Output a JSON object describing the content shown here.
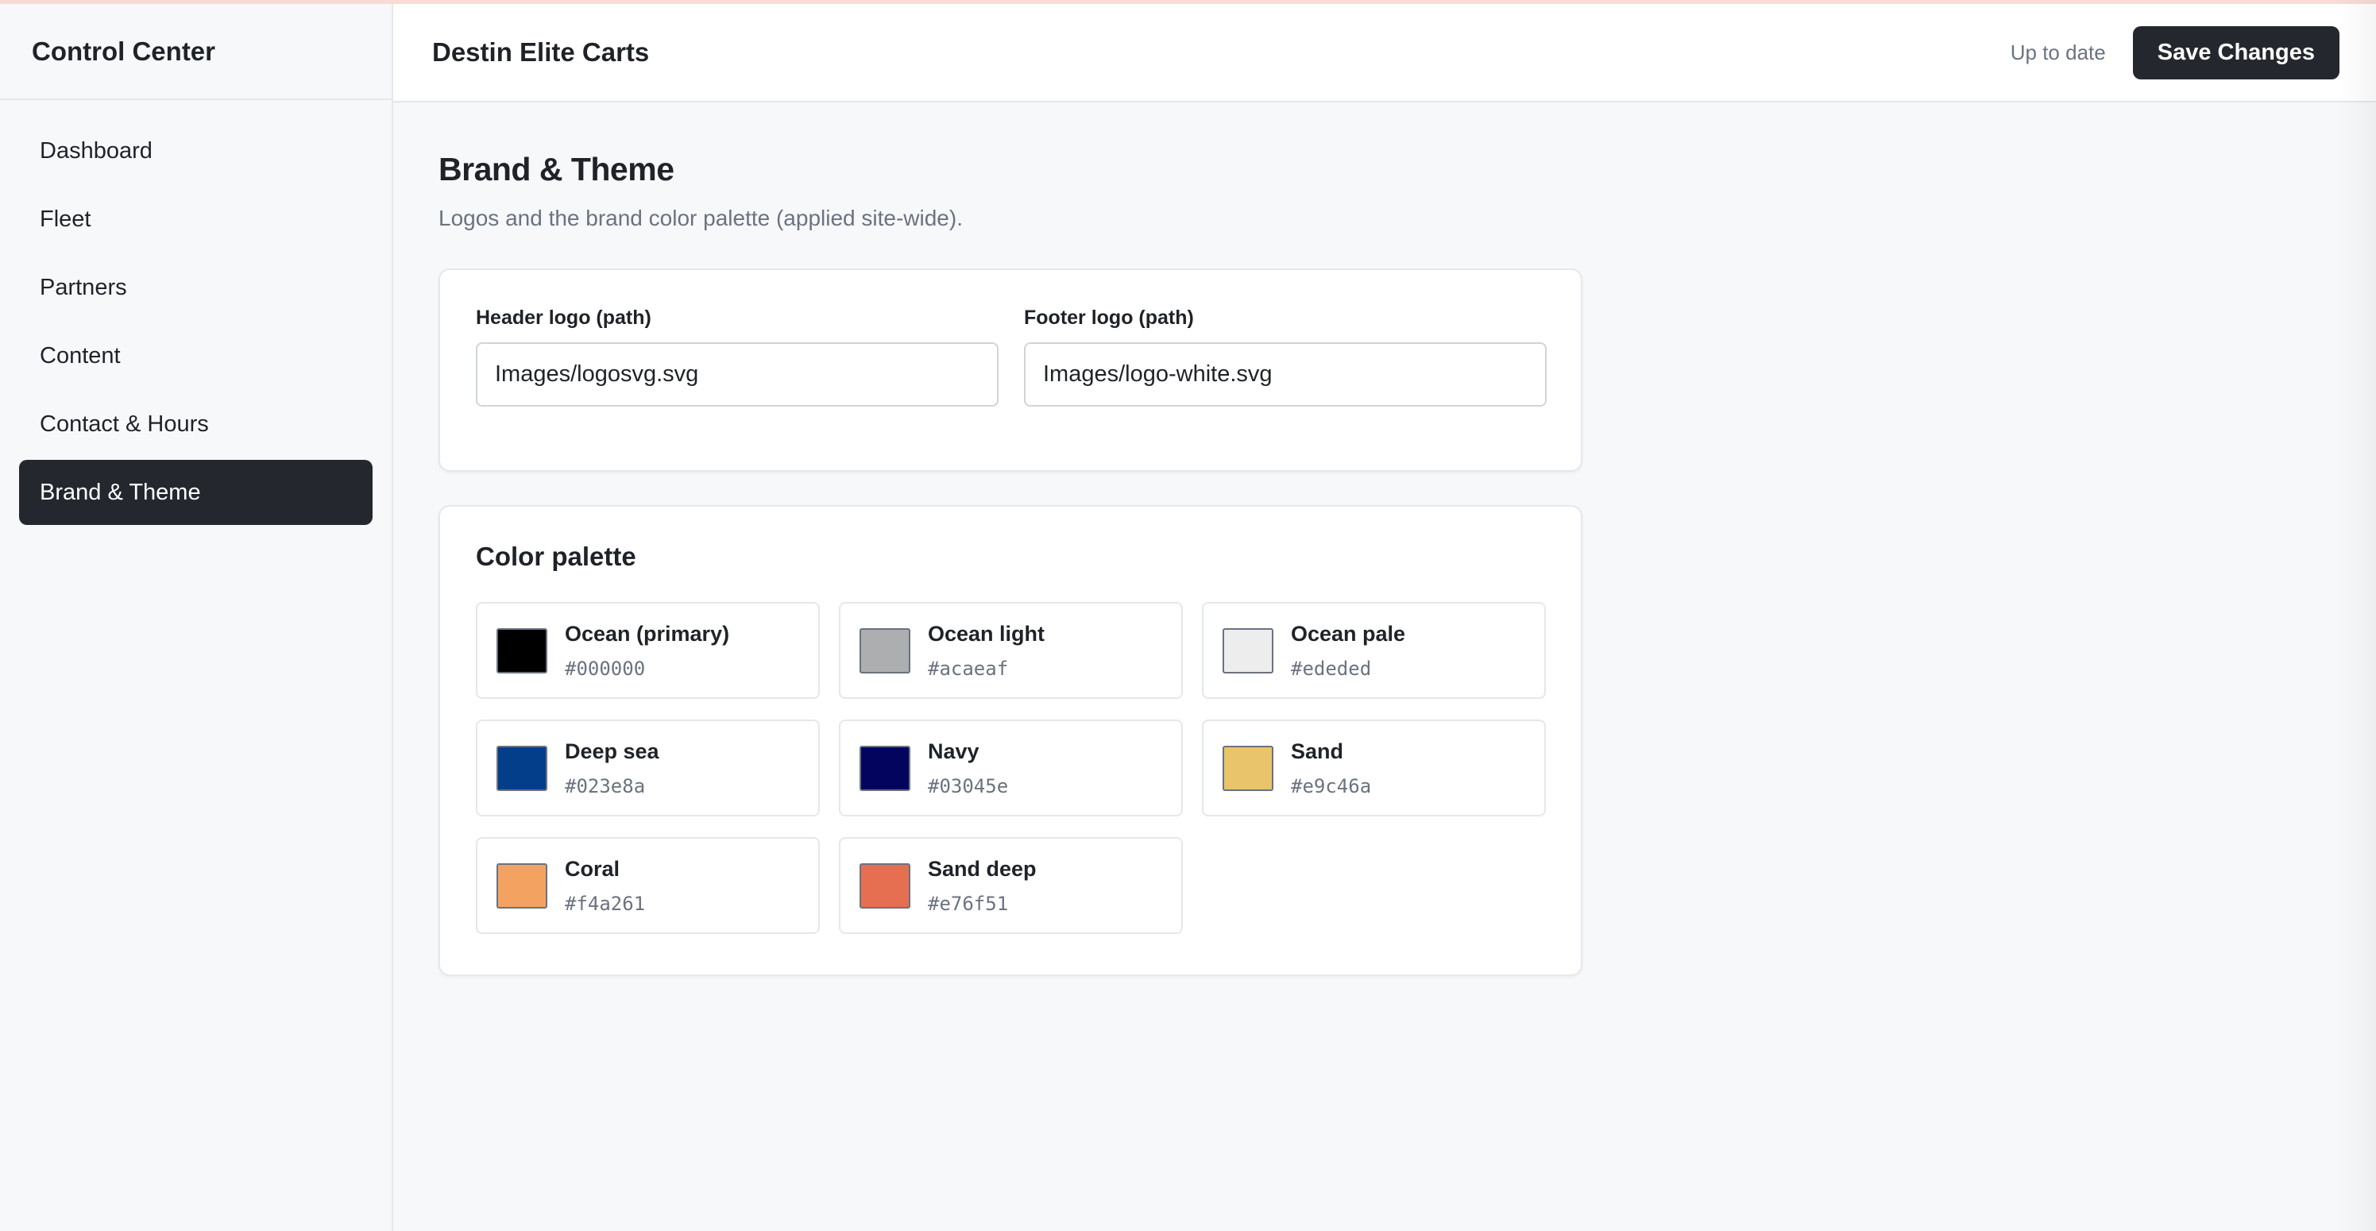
{
  "sidebar": {
    "title": "Control Center",
    "items": [
      {
        "label": "Dashboard"
      },
      {
        "label": "Fleet"
      },
      {
        "label": "Partners"
      },
      {
        "label": "Content"
      },
      {
        "label": "Contact & Hours"
      },
      {
        "label": "Brand & Theme",
        "active": true
      }
    ]
  },
  "header": {
    "site_name": "Destin Elite Carts",
    "status": "Up to date",
    "save_label": "Save Changes"
  },
  "page": {
    "title": "Brand & Theme",
    "subtitle": "Logos and the brand color palette (applied site-wide)."
  },
  "logos": {
    "header": {
      "label": "Header logo (path)",
      "value": "Images/logosvg.svg"
    },
    "footer": {
      "label": "Footer logo (path)",
      "value": "Images/logo-white.svg"
    }
  },
  "palette": {
    "title": "Color palette",
    "colors": [
      {
        "name": "Ocean (primary)",
        "hex": "#000000"
      },
      {
        "name": "Ocean light",
        "hex": "#acaeaf"
      },
      {
        "name": "Ocean pale",
        "hex": "#ededed"
      },
      {
        "name": "Deep sea",
        "hex": "#023e8a"
      },
      {
        "name": "Navy",
        "hex": "#03045e"
      },
      {
        "name": "Sand",
        "hex": "#e9c46a"
      },
      {
        "name": "Coral",
        "hex": "#f4a261"
      },
      {
        "name": "Sand deep",
        "hex": "#e76f51"
      }
    ]
  },
  "theme": {
    "accent_dark": "#24282e",
    "top_accent": "#f6dcd5"
  }
}
